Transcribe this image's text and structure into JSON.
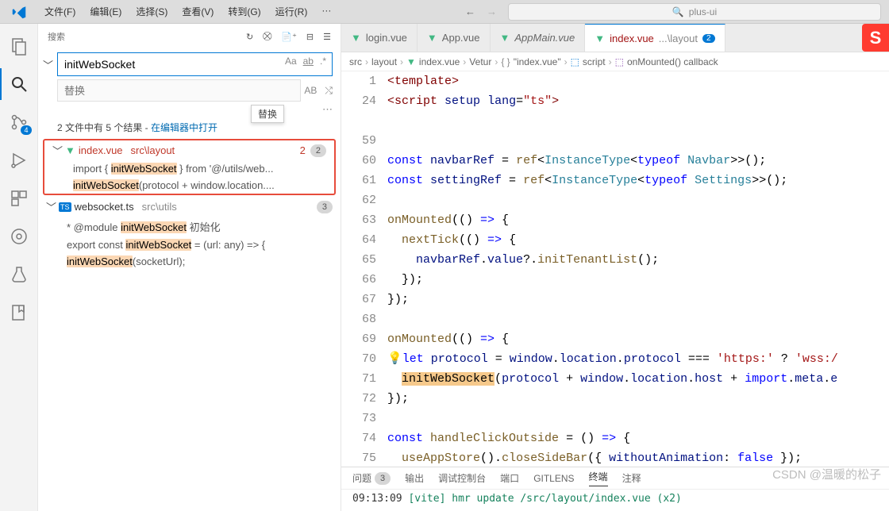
{
  "menubar": {
    "items": [
      "文件(F)",
      "编辑(E)",
      "选择(S)",
      "查看(V)",
      "转到(G)",
      "运行(R)",
      "···"
    ]
  },
  "command_center": {
    "placeholder": "plus-ui"
  },
  "activitybar": {
    "scm_badge": "4"
  },
  "search_panel": {
    "title": "搜索",
    "query": "initWebSocket",
    "replace_placeholder": "替换",
    "tooltip": "替换",
    "case_label": "Aa",
    "word_label": "ab",
    "regex_label": ".*",
    "preserve_label": "AB",
    "summary_prefix": "2 文件中有 5 个结果 - ",
    "summary_link": "在编辑器中打开"
  },
  "results": [
    {
      "file": "index.vue",
      "path": "src\\layout",
      "highlight": true,
      "hit_count": "2",
      "badge_count": "2",
      "matches": [
        {
          "pre": "import { ",
          "hit": "initWebSocket",
          "post": " } from '@/utils/web..."
        },
        {
          "pre": "",
          "hit": "initWebSocket",
          "post": "(protocol + window.location...."
        }
      ]
    },
    {
      "file": "websocket.ts",
      "path": "src\\utils",
      "highlight": false,
      "hit_count": "",
      "badge_count": "3",
      "matches": [
        {
          "pre": "* @module ",
          "hit": "initWebSocket",
          "post": " 初始化"
        },
        {
          "pre": "export const ",
          "hit": "initWebSocket",
          "post": " = (url: any) => {"
        },
        {
          "pre": "",
          "hit": "initWebSocket",
          "post": "(socketUrl);"
        }
      ]
    }
  ],
  "tabs": [
    {
      "label": "login.vue",
      "italic": false
    },
    {
      "label": "App.vue",
      "italic": false
    },
    {
      "label": "AppMain.vue",
      "italic": true
    },
    {
      "label": "index.vue",
      "path": "...\\layout",
      "active": true,
      "badge": "2"
    }
  ],
  "breadcrumb": {
    "p1": "src",
    "p2": "layout",
    "p3": "index.vue",
    "p4": "Vetur",
    "p5": "\"index.vue\"",
    "p6": "script",
    "p7": "onMounted() callback"
  },
  "code": {
    "lines": [
      {
        "n": "1",
        "html": "<span class='tok-tag'>&lt;template&gt;</span>"
      },
      {
        "n": "24",
        "html": "<span class='tok-tag'>&lt;script</span> <span class='tok-prop'>setup</span> <span class='tok-prop'>lang</span>=<span class='tok-str'>\"ts\"</span><span class='tok-tag'>&gt;</span>"
      },
      {
        "n": "",
        "html": ""
      },
      {
        "n": "59",
        "html": ""
      },
      {
        "n": "60",
        "html": "<span class='tok-kw'>const</span> <span class='tok-prop'>navbarRef</span> = <span class='tok-fn'>ref</span>&lt;<span class='tok-type'>InstanceType</span>&lt;<span class='tok-kw'>typeof</span> <span class='tok-type'>Navbar</span>&gt;&gt;();"
      },
      {
        "n": "61",
        "html": "<span class='tok-kw'>const</span> <span class='tok-prop'>settingRef</span> = <span class='tok-fn'>ref</span>&lt;<span class='tok-type'>InstanceType</span>&lt;<span class='tok-kw'>typeof</span> <span class='tok-type'>Settings</span>&gt;&gt;();"
      },
      {
        "n": "62",
        "html": ""
      },
      {
        "n": "63",
        "html": "<span class='tok-fn'>onMounted</span>(() <span class='tok-kw'>=&gt;</span> {"
      },
      {
        "n": "64",
        "html": "  <span class='tok-fn'>nextTick</span>(() <span class='tok-kw'>=&gt;</span> {"
      },
      {
        "n": "65",
        "html": "    <span class='tok-prop'>navbarRef</span>.<span class='tok-prop'>value</span>?.<span class='tok-fn'>initTenantList</span>();"
      },
      {
        "n": "66",
        "html": "  });"
      },
      {
        "n": "67",
        "html": "});"
      },
      {
        "n": "68",
        "html": ""
      },
      {
        "n": "69",
        "html": "<span class='tok-fn'>onMounted</span>(() <span class='tok-kw'>=&gt;</span> {"
      },
      {
        "n": "70",
        "html": "<span class='bulb'>💡</span><span class='tok-kw'>let</span> <span class='tok-prop'>protocol</span> = <span class='tok-prop'>window</span>.<span class='tok-prop'>location</span>.<span class='tok-prop'>protocol</span> === <span class='tok-str'>'https:'</span> ? <span class='tok-str'>'wss:/</span>"
      },
      {
        "n": "71",
        "html": "  <span class='sel-hl'>initWebSocket</span>(<span class='tok-prop'>protocol</span> + <span class='tok-prop'>window</span>.<span class='tok-prop'>location</span>.<span class='tok-prop'>host</span> + <span class='tok-kw'>import</span>.<span class='tok-prop'>meta</span>.<span class='tok-prop'>e</span>"
      },
      {
        "n": "72",
        "html": "});"
      },
      {
        "n": "73",
        "html": ""
      },
      {
        "n": "74",
        "html": "<span class='tok-kw'>const</span> <span class='tok-fn'>handleClickOutside</span> = () <span class='tok-kw'>=&gt;</span> {"
      },
      {
        "n": "75",
        "html": "  <span class='tok-fn'>useAppStore</span>().<span class='tok-fn'>closeSideBar</span>({ <span class='tok-prop'>withoutAnimation</span>: <span class='tok-kw'>false</span> });"
      }
    ]
  },
  "panel": {
    "tabs": {
      "problems": "问题",
      "problems_badge": "3",
      "output": "输出",
      "debug": "调试控制台",
      "ports": "端口",
      "gitlens": "GITLENS",
      "terminal": "终端",
      "comments": "注释"
    },
    "terminal_line_time": "09:13:09",
    "terminal_line_vite": "[vite]",
    "terminal_line_rest": "hmr update /src/layout/index.vue (x2)"
  },
  "watermark": "CSDN @温暖的松子"
}
